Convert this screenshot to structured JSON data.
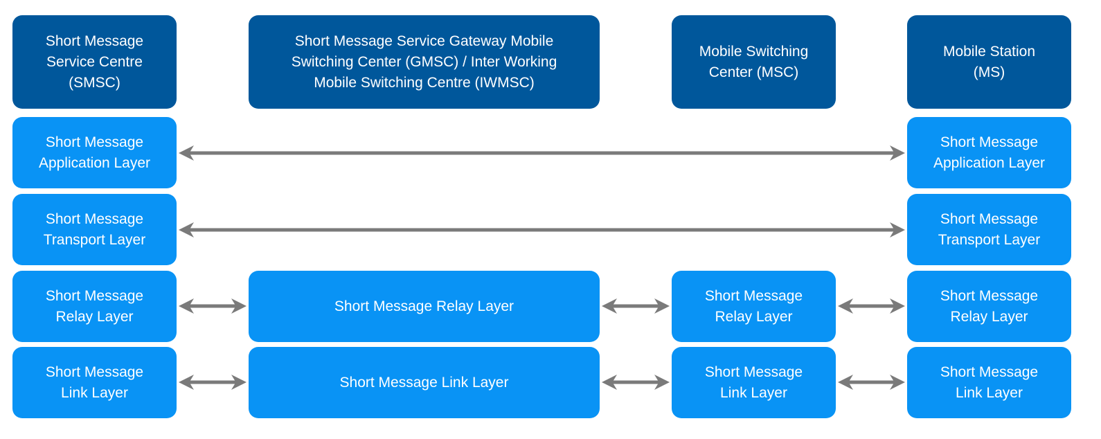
{
  "colors": {
    "header": "#00579b",
    "layer": "#0993f5",
    "arrow": "#7a7a7a"
  },
  "entities": [
    {
      "id": "smsc",
      "label": "Short Message\nService Centre\n(SMSC)"
    },
    {
      "id": "gmsc",
      "label": "Short Message Service Gateway Mobile\nSwitching Center (GMSC) / Inter Working\nMobile Switching Centre (IWMSC)"
    },
    {
      "id": "msc",
      "label": "Mobile Switching\nCenter (MSC)"
    },
    {
      "id": "ms",
      "label": "Mobile Station\n(MS)"
    }
  ],
  "layers": {
    "smsc": [
      "Short Message\nApplication Layer",
      "Short Message\nTransport Layer",
      "Short Message\nRelay Layer",
      "Short Message\nLink Layer"
    ],
    "gmsc": [
      "Short Message Relay Layer",
      "Short Message Link Layer"
    ],
    "msc": [
      "Short Message\nRelay Layer",
      "Short Message\nLink Layer"
    ],
    "ms": [
      "Short Message\nApplication Layer",
      "Short Message\nTransport Layer",
      "Short Message\nRelay Layer",
      "Short Message\nLink Layer"
    ]
  },
  "connections": [
    {
      "from": "smsc.application",
      "to": "ms.application"
    },
    {
      "from": "smsc.transport",
      "to": "ms.transport"
    },
    {
      "from": "smsc.relay",
      "to": "gmsc.relay"
    },
    {
      "from": "gmsc.relay",
      "to": "msc.relay"
    },
    {
      "from": "msc.relay",
      "to": "ms.relay"
    },
    {
      "from": "smsc.link",
      "to": "gmsc.link"
    },
    {
      "from": "gmsc.link",
      "to": "msc.link"
    },
    {
      "from": "msc.link",
      "to": "ms.link"
    }
  ]
}
